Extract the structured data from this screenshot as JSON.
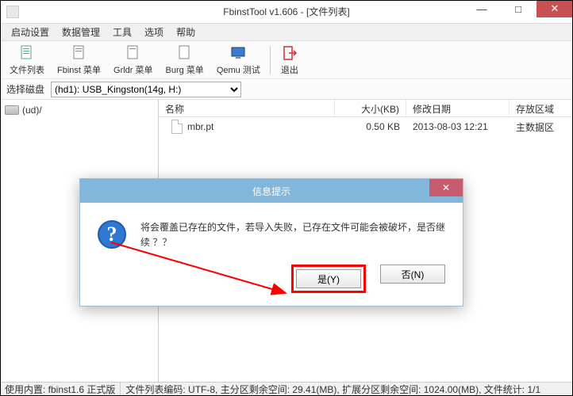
{
  "window": {
    "title": "FbinstTool v1.606 - [文件列表]"
  },
  "menu": {
    "items": [
      "启动设置",
      "数据管理",
      "工具",
      "选项",
      "帮助"
    ]
  },
  "toolbar": {
    "items": [
      "文件列表",
      "Fbinst 菜单",
      "Grldr 菜单",
      "Burg 菜单",
      "Qemu 测试"
    ],
    "exit": "退出"
  },
  "disk": {
    "label": "选择磁盘",
    "value": "(hd1): USB_Kingston(14g, H:)"
  },
  "tree": {
    "root": "(ud)/"
  },
  "columns": {
    "name": "名称",
    "size": "大小(KB)",
    "date": "修改日期",
    "area": "存放区域"
  },
  "files": [
    {
      "name": "mbr.pt",
      "size": "0.50 KB",
      "date": "2013-08-03 12:21",
      "area": "主数据区"
    }
  ],
  "status": {
    "left": "使用内置: fbinst1.6 正式版",
    "right": "文件列表编码: UTF-8, 主分区剩余空间: 29.41(MB), 扩展分区剩余空间: 1024.00(MB), 文件统计: 1/1"
  },
  "dialog": {
    "title": "信息提示",
    "message": "将会覆盖已存在的文件，若导入失败，已存在文件可能会被破坏，是否继续 ？？",
    "yes": "是(Y)",
    "no": "否(N)"
  }
}
